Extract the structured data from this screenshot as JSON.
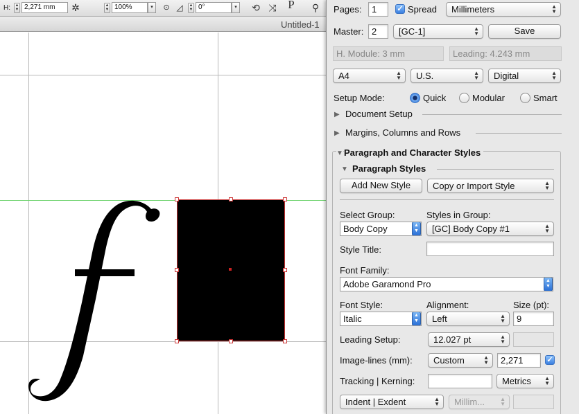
{
  "toolbar": {
    "height_label": "H:",
    "height_value": "2,271 mm",
    "scale_value": "100%",
    "rotation_value": "0°",
    "paragraph_glyph": "P"
  },
  "document": {
    "title": "Untitled-1"
  },
  "panel": {
    "pages_label": "Pages:",
    "pages_value": "1",
    "spread_label": "Spread",
    "spread_checked": true,
    "units_value": "Millimeters",
    "master_label": "Master:",
    "master_value": "2",
    "master_select_value": "[GC-1]",
    "save_label": "Save",
    "h_module_text": "H. Module: 3 mm",
    "leading_text": "Leading: 4.243 mm",
    "page_size_value": "A4",
    "region_value": "U.S.",
    "output_value": "Digital",
    "setup_mode_label": "Setup Mode:",
    "setup_mode_options": [
      "Quick",
      "Modular",
      "Smart"
    ],
    "setup_mode_selected": "Quick",
    "document_setup_label": "Document Setup",
    "margins_label": "Margins, Columns and Rows",
    "para_char_styles_label": "Paragraph and Character Styles",
    "paragraph_styles_label": "Paragraph Styles",
    "add_new_style_label": "Add New Style",
    "copy_import_label": "Copy or Import Style",
    "select_group_label": "Select Group:",
    "select_group_value": "Body Copy",
    "styles_in_group_label": "Styles in Group:",
    "styles_in_group_value": "[GC] Body Copy #1",
    "style_title_label": "Style Title:",
    "style_title_value": "",
    "font_family_label": "Font Family:",
    "font_family_value": "Adobe Garamond Pro",
    "font_style_label": "Font Style:",
    "font_style_value": "Italic",
    "alignment_label": "Alignment:",
    "alignment_value": "Left",
    "size_label": "Size (pt):",
    "size_value": "9",
    "leading_setup_label": "Leading Setup:",
    "leading_setup_value": "12.027 pt",
    "leading_setup_extra": "",
    "image_lines_label": "Image-lines (mm):",
    "image_lines_mode": "Custom",
    "image_lines_value": "2,271",
    "image_lines_checked": true,
    "tracking_label": "Tracking | Kerning:",
    "tracking_value": "",
    "kerning_value": "Metrics",
    "indent_label": "Indent | Exdent",
    "indent_unit": "Millim...",
    "indent_value": ""
  },
  "colors": {
    "accent_blue": "#3a7fe0",
    "frame_outline": "#cc3333",
    "baseline_guide": "#6fd36f",
    "panel_bg": "#e8e8e8"
  }
}
